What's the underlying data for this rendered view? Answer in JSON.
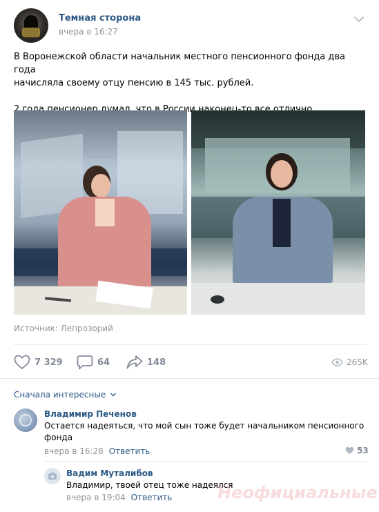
{
  "post": {
    "author": "Темная сторона",
    "time": "вчера в 16:27",
    "text_line1": "В Воронежской области начальник местного пенсионного фонда два года",
    "text_line2": "начисляла своему отцу пенсию в 145 тыс. рублей.",
    "text_line3": "2 года пенсионер думал, что в России наконец-то все отлично",
    "source": "Источник: Лепрозорий",
    "likes": "7 329",
    "comments": "64",
    "shares": "148",
    "views": "265K"
  },
  "comments_section": {
    "sort_label": "Сначала интересные",
    "items": [
      {
        "name": "Владимир Печенов",
        "text_line1": "Остается надеяться, что мой сын тоже будет начальником пенсионного",
        "text_line2": "фонда",
        "time": "вчера в 16:28",
        "reply_label": "Ответить",
        "likes": "53"
      },
      {
        "name": "Вадим Муталибов",
        "text": "Владимир, твоей отец тоже надеялся",
        "time": "вчера в 19:04",
        "reply_label": "Ответить"
      }
    ]
  },
  "watermark": "Неофициальные сети",
  "colors": {
    "link": "#2a5885",
    "meta": "#939393",
    "icon": "#828a99",
    "divider": "#e7e8ec"
  },
  "icons": [
    "heart-icon",
    "comment-icon",
    "share-icon",
    "eye-icon",
    "chevron-down-icon"
  ]
}
